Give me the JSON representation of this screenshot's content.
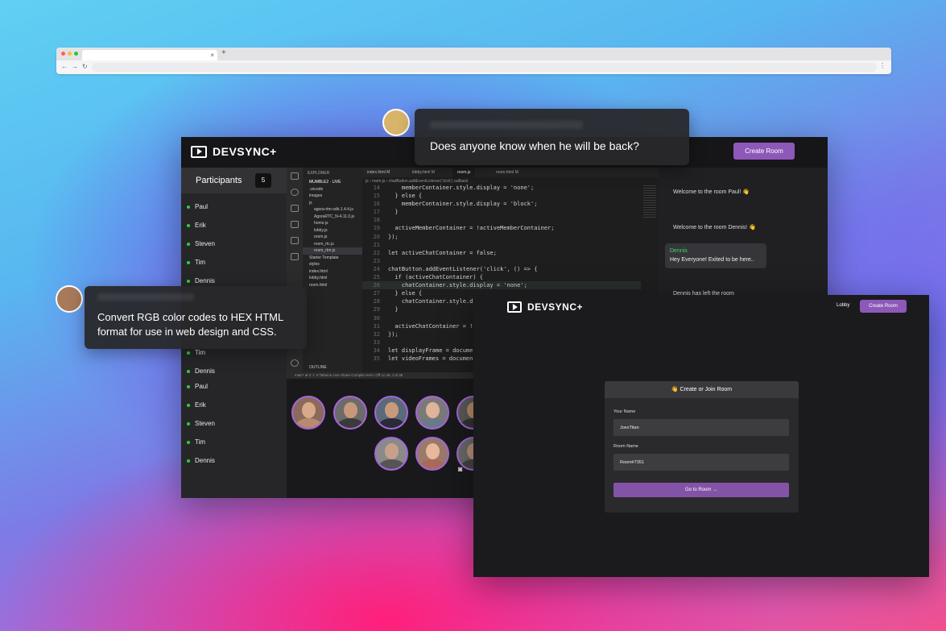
{
  "browser": {
    "dots": [
      "#ff5f57",
      "#febc2e",
      "#28c840"
    ],
    "tab_close": "×",
    "tab_new": "+",
    "nav": [
      "←",
      "→",
      "↻"
    ],
    "menu": "⋮"
  },
  "app": {
    "brand": "DEVSYNC+",
    "create_room": "Create Room",
    "participants_title": "Participants",
    "participants_count": "5",
    "participants": [
      "Paul",
      "Erik",
      "Steven",
      "Tim",
      "Dennis",
      "Tim",
      "Dennis",
      "Paul",
      "Erik",
      "Steven",
      "Tim",
      "Dennis"
    ],
    "chat": {
      "welcome_paul": "Welcome to the room Paul! 👋",
      "welcome_dennis": "Welcome to the room Dennis! 👋",
      "bubble_name": "Dennis",
      "bubble_text": "Hey Everyone! Exited to be here..",
      "left_msg": "Dennis has left the room"
    }
  },
  "ide": {
    "explorer_title": "EXPLORER",
    "project": "MUMBLE2 · LIVE",
    "files": [
      ".vscode",
      "images",
      "js",
      "agora-rtm-sdk-1.4.4.js",
      "AgoraRTC_N-4.11.0.js",
      "home.js",
      "lobby.js",
      "room.js",
      "room_rtc.js",
      "room_rtm.js",
      "Starter Template",
      "styles",
      "index.html",
      "lobby.html",
      "room.html"
    ],
    "outline": "OUTLINE",
    "tabs": [
      "index.html M",
      "lobby.html M",
      "room.js",
      "room.html M"
    ],
    "breadcrumb": "js › room.js › chatButton.addEventListener('click') callback",
    "lines": [
      {
        "n": "14",
        "t": "    memberContainer.style.display = 'none';"
      },
      {
        "n": "15",
        "t": "  } else {"
      },
      {
        "n": "16",
        "t": "    memberContainer.style.display = 'block';"
      },
      {
        "n": "17",
        "t": "  }"
      },
      {
        "n": "18",
        "t": ""
      },
      {
        "n": "19",
        "t": "  activeMemberContainer = !activeMemberContainer;"
      },
      {
        "n": "20",
        "t": "});"
      },
      {
        "n": "21",
        "t": ""
      },
      {
        "n": "22",
        "t": "let activeChatContainer = false;"
      },
      {
        "n": "23",
        "t": ""
      },
      {
        "n": "24",
        "t": "chatButton.addEventListener('click', () => {"
      },
      {
        "n": "25",
        "t": "  if (activeChatContainer) {"
      },
      {
        "n": "26",
        "t": "    chatContainer.style.display = 'none';"
      },
      {
        "n": "27",
        "t": "  } else {"
      },
      {
        "n": "28",
        "t": "    chatContainer.style.display = 'block';"
      },
      {
        "n": "29",
        "t": "  }"
      },
      {
        "n": "30",
        "t": ""
      },
      {
        "n": "31",
        "t": "  activeChatContainer = !activeChatContainer;"
      },
      {
        "n": "32",
        "t": "});"
      },
      {
        "n": "33",
        "t": ""
      },
      {
        "n": "34",
        "t": "let displayFrame = document.getElementById('stream__box');"
      },
      {
        "n": "35",
        "t": "let videoFrames = document.getElementsByClassName('video__container');"
      }
    ],
    "status": "main*   ⊗ 0 ⚠ 0   Tabnine   Live Share   Compile Hero: Off   Ln 26, Col 38"
  },
  "lobby": {
    "brand": "DEVSYNC+",
    "lobby_link": "Lobby",
    "create_room": "Create Room",
    "form_title": "👋 Create or Join Room",
    "name_label": "Your Name",
    "name_value": "JoexTitan",
    "room_label": "Room Name",
    "room_value": "Room#7351",
    "go_button": "Go to Room →"
  },
  "tooltips": {
    "top": "Does anyone know when he will be back?",
    "left": "Convert RGB color codes to HEX HTML format for use in web design and CSS."
  },
  "colors": {
    "accent": "#8e58b8",
    "online": "#2ecc40",
    "chat_name": "#40d96a"
  }
}
